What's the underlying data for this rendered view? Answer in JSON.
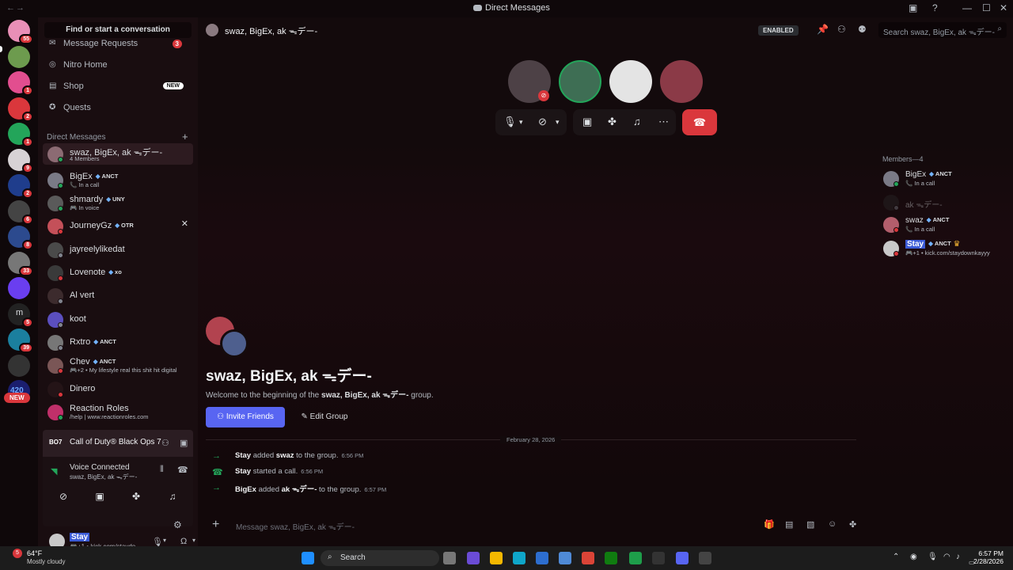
{
  "window": {
    "title": "Direct Messages",
    "back": "←",
    "forward": "→"
  },
  "sidebar": {
    "find_placeholder": "Find or start a conversation",
    "nav": [
      {
        "label": "Message Requests",
        "badge": "3"
      },
      {
        "label": "Nitro Home"
      },
      {
        "label": "Shop",
        "badge": "NEW"
      },
      {
        "label": "Quests"
      }
    ],
    "dm_header": "Direct Messages",
    "dms": [
      {
        "name": "swaz, BigEx, ak ᯓデー-",
        "sub": "4 Members",
        "color": "#8c6b73",
        "status": "#23a55a"
      },
      {
        "name": "BigEx",
        "tag": "ANCT",
        "sub": "📞 In a call",
        "color": "#7a7a86",
        "status": "#23a55a"
      },
      {
        "name": "shmardy",
        "tag": "UNY",
        "sub": "🎮 In voice",
        "color": "#5a5a5a",
        "status": "#23a55a"
      },
      {
        "name": "JourneyGz",
        "tag": "OTR",
        "color": "#c45059",
        "status": "#da373c",
        "close": "✕"
      },
      {
        "name": "jayreelylikedat",
        "color": "#4a4a4a",
        "status": "#80848e"
      },
      {
        "name": "Lovenote",
        "tag": "xo",
        "color": "#3a3a3a",
        "status": "#da373c"
      },
      {
        "name": "Al vert",
        "color": "#3c2b2d",
        "status": "#80848e"
      },
      {
        "name": "koot",
        "color": "#5b4fbf",
        "status": "#80848e"
      },
      {
        "name": "Rxtro",
        "tag": "ANCT",
        "color": "#777777",
        "status": "#80848e"
      },
      {
        "name": "Chev",
        "tag": "ANCT",
        "sub": "🎮+2 • My lifestyle real this shit hit digital",
        "color": "#7a5656",
        "status": "#da373c"
      },
      {
        "name": "Dinero",
        "color": "#241417",
        "status": "#da373c"
      },
      {
        "name": "Reaction Roles",
        "sub": "/help | www.reactionroles.com",
        "color": "#c0306a",
        "status": "#23a55a"
      }
    ],
    "servers": [
      {
        "badge": "55",
        "color": "#e98fb7"
      },
      {
        "badge": "",
        "color": "#6d9b4e"
      },
      {
        "badge": "1",
        "color": "#e24e8f"
      },
      {
        "badge": "2",
        "color": "#da373c"
      },
      {
        "badge": "1",
        "color": "#23a55a"
      },
      {
        "badge": "9",
        "color": "#d7d2d5"
      },
      {
        "badge": "2",
        "color": "#1f3d8c"
      },
      {
        "badge": "6",
        "color": "#444"
      },
      {
        "badge": "8",
        "color": "#2c4a8e"
      },
      {
        "badge": "33",
        "color": "#777"
      },
      {
        "badge": "",
        "color": "#6a3ef0"
      },
      {
        "badge": "5",
        "color": "#222"
      },
      {
        "badge": "39",
        "color": "#1b7f9e"
      },
      {
        "badge": "",
        "color": "#333"
      },
      {
        "badge": "",
        "color": "#1b1e6e"
      }
    ],
    "server_m_label": "m",
    "server_420_label": "420",
    "new_pill": "NEW",
    "game": {
      "logo": "BO7",
      "title": "Call of Duty® Black Ops 7"
    },
    "voice": {
      "status": "Voice Connected",
      "channel": "swaz, BigEx, ak ᯓデー-"
    },
    "user": {
      "name": "Stay",
      "sub": "🎮+1 • kick.com/staydo"
    }
  },
  "header": {
    "title": "swaz, BigEx, ak ᯓデー-",
    "enabled": "ENABLED",
    "search_placeholder": "Search swaz, BigEx, ak ᯓデー-"
  },
  "call": {
    "avatars": [
      "#4d4146",
      "#3e6e54",
      "#e4e4e4",
      "#8b3a47"
    ]
  },
  "group": {
    "title": "swaz, BigEx, ak ᯓデー-",
    "welcome_prefix": "Welcome to the beginning of the ",
    "welcome_name": "swaz, BigEx, ak ᯓデー-",
    "welcome_suffix": " group.",
    "invite": "Invite Friends",
    "edit": "Edit Group"
  },
  "divider_date": "February 28, 2026",
  "system_messages": [
    {
      "actor": "Stay",
      "text": " added ",
      "target": "swaz",
      "after": " to the group.",
      "time": "6:56 PM"
    },
    {
      "actor": "Stay",
      "text": " started a call.",
      "target": "",
      "after": "",
      "time": "6:56 PM"
    },
    {
      "actor": "BigEx",
      "text": " added ",
      "target": "ak ᯓデー-",
      "after": " to the group.",
      "time": "6:57 PM"
    }
  ],
  "composer": {
    "placeholder": "Message swaz, BigEx, ak ᯓデー-"
  },
  "members": {
    "header": "Members—4",
    "list": [
      {
        "name": "BigEx",
        "tag": "ANCT",
        "sub": "📞 In a call",
        "color": "#7a7a86",
        "status": "#23a55a"
      },
      {
        "name": "ak ᯓデー-",
        "color": "#2a2a2a",
        "status": "#80848e"
      },
      {
        "name": "swaz",
        "tag": "ANCT",
        "sub": "📞 In a call",
        "color": "#b35e6c",
        "status": "#da373c"
      },
      {
        "name": "Stay",
        "tag": "ANCT",
        "sub": "🎮+1 • kick.com/staydownkayyy",
        "color": "#c9c9c9",
        "status": "#da373c"
      }
    ]
  },
  "taskbar": {
    "weather_temp": "64°F",
    "weather_desc": "Mostly cloudy",
    "weather_badge": "5",
    "search": "Search",
    "time": "6:57 PM",
    "date": "2/28/2026"
  }
}
